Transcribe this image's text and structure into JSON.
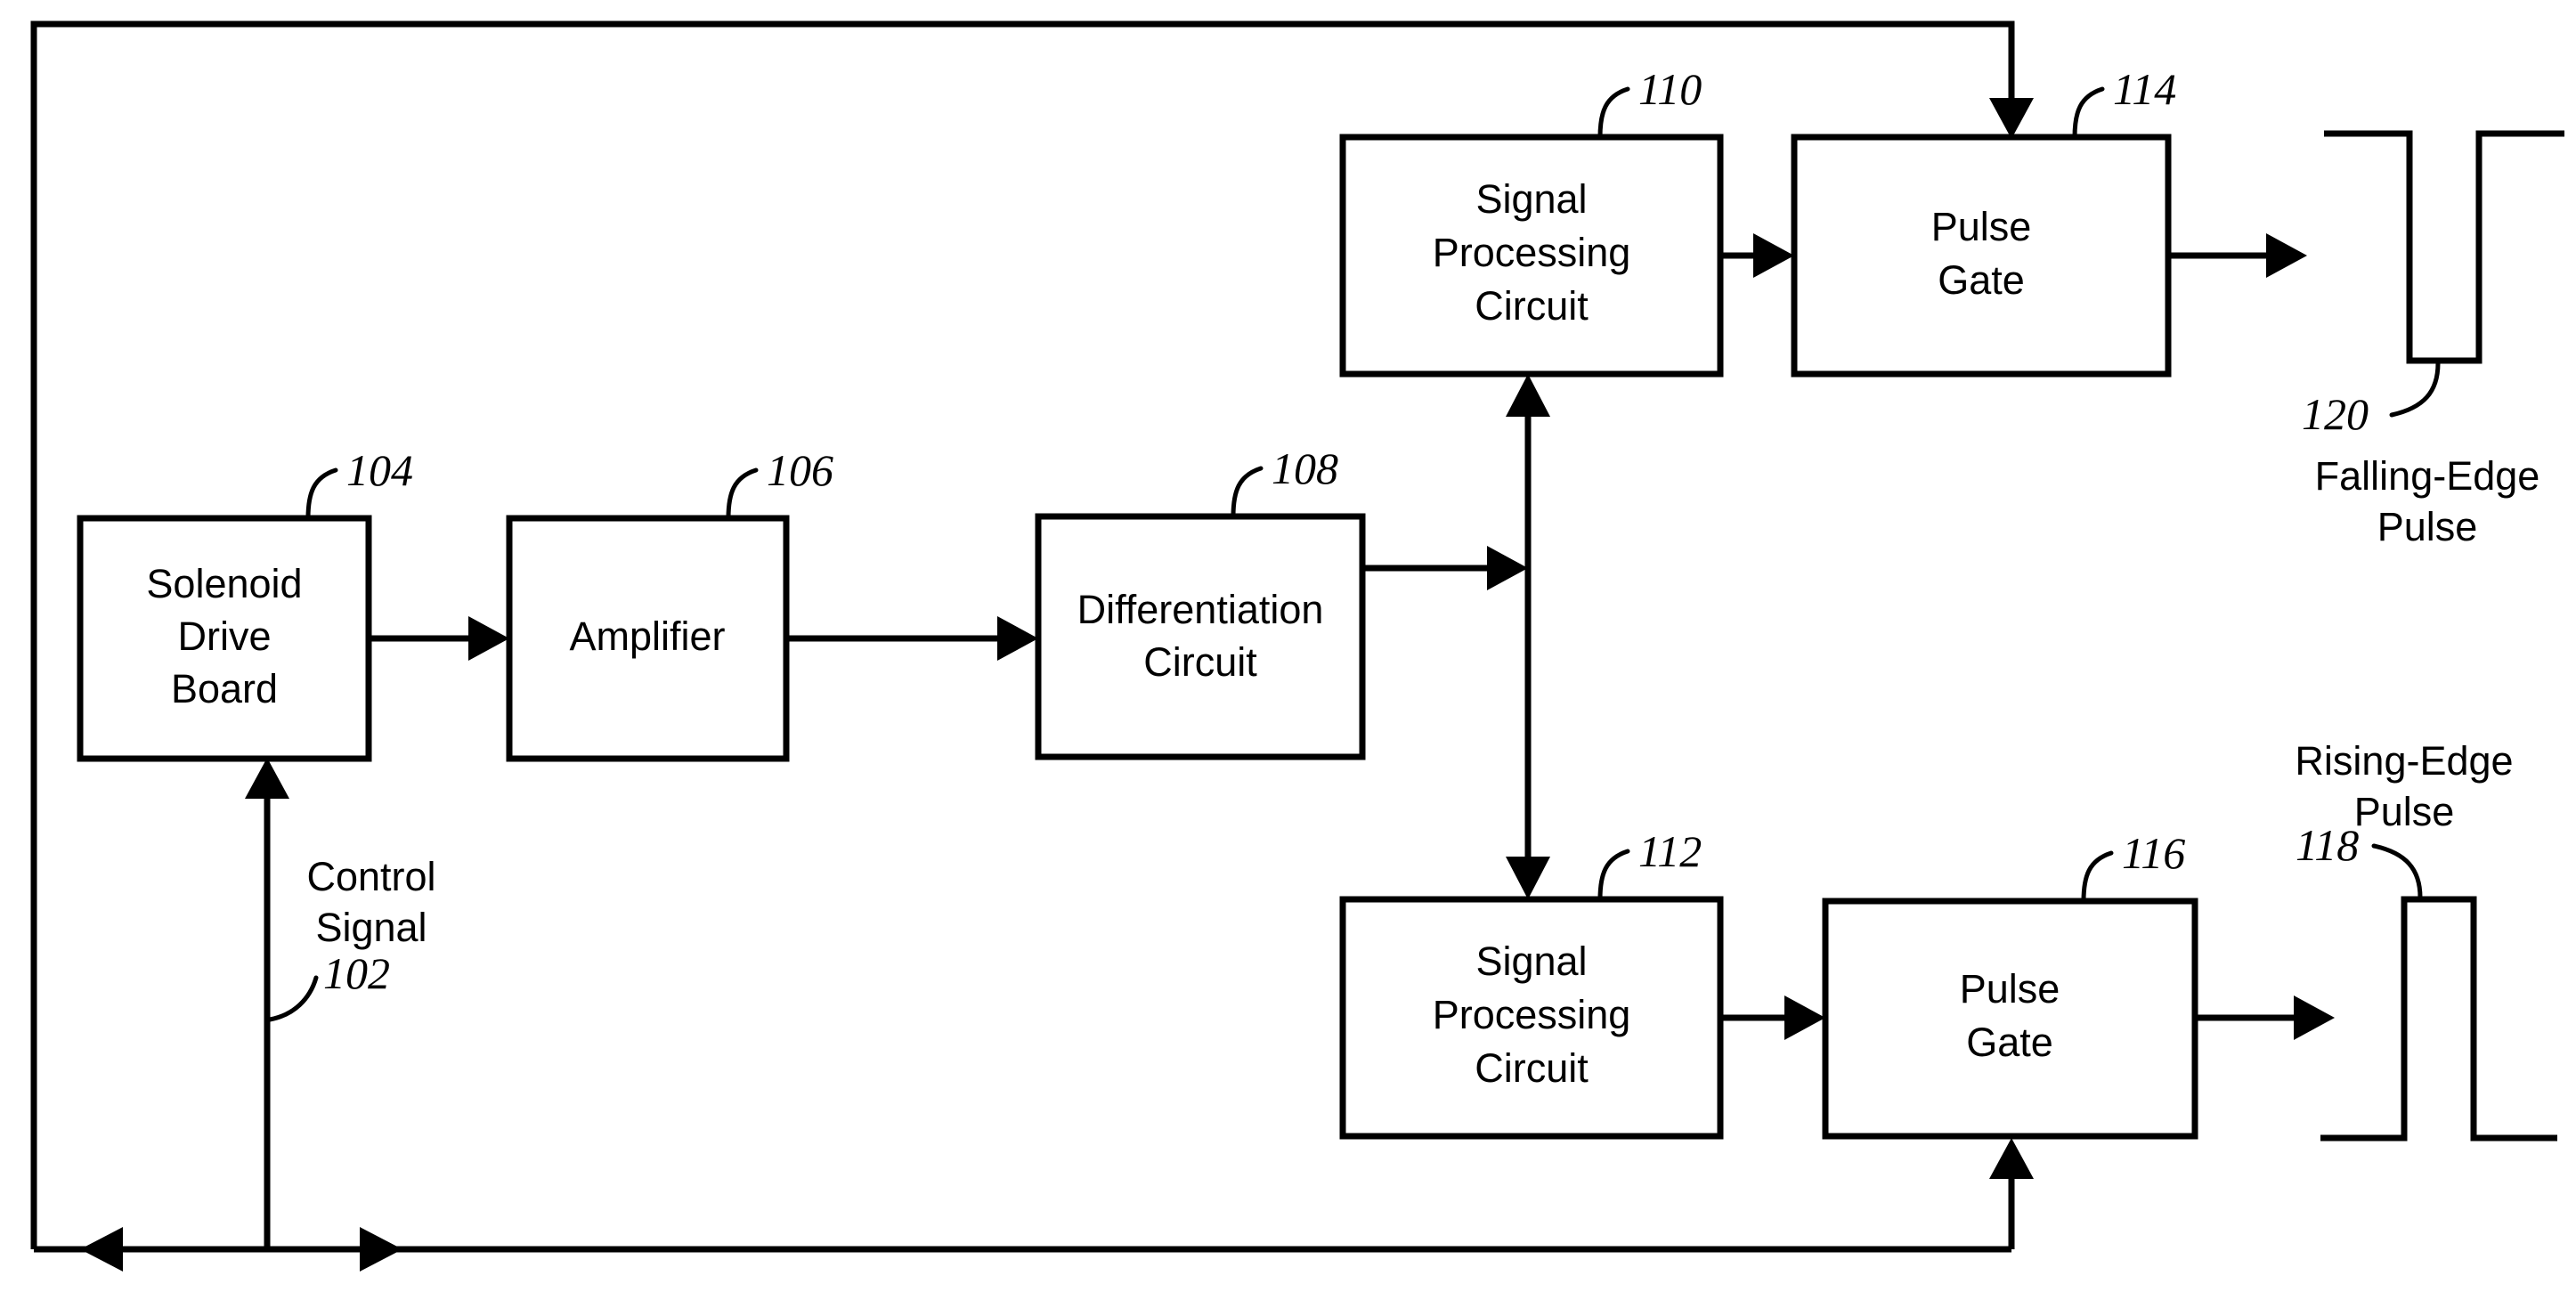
{
  "figure": {
    "type": "patent-block-diagram",
    "background_color": "#ffffff",
    "line_color": "#000000"
  },
  "blocks": [
    {
      "id": "solenoid-drive-board",
      "ref": "104",
      "lines": [
        "Solenoid",
        "Drive",
        "Board"
      ]
    },
    {
      "id": "amplifier",
      "ref": "106",
      "lines": [
        "Amplifier"
      ]
    },
    {
      "id": "differentiation-circuit",
      "ref": "108",
      "lines": [
        "Differentiation",
        "Circuit"
      ]
    },
    {
      "id": "signal-processing-circuit-upper",
      "ref": "110",
      "lines": [
        "Signal",
        "Processing",
        "Circuit"
      ]
    },
    {
      "id": "signal-processing-circuit-lower",
      "ref": "112",
      "lines": [
        "Signal",
        "Processing",
        "Circuit"
      ]
    },
    {
      "id": "pulse-gate-upper",
      "ref": "114",
      "lines": [
        "Pulse",
        "Gate"
      ]
    },
    {
      "id": "pulse-gate-lower",
      "ref": "116",
      "lines": [
        "Pulse",
        "Gate"
      ]
    }
  ],
  "signals": {
    "control_signal": {
      "line1": "Control",
      "line2": "Signal",
      "ref": "102"
    },
    "falling_edge_pulse": {
      "line1": "Falling-Edge",
      "line2": "Pulse",
      "ref": "120"
    },
    "rising_edge_pulse": {
      "line1": "Rising-Edge",
      "line2": "Pulse",
      "ref": "118"
    }
  },
  "refs": {
    "r102": "102",
    "r104": "104",
    "r106": "106",
    "r108": "108",
    "r110": "110",
    "r112": "112",
    "r114": "114",
    "r116": "116",
    "r118": "118",
    "r120": "120"
  },
  "labels": {
    "solenoid_l1": "Solenoid",
    "solenoid_l2": "Drive",
    "solenoid_l3": "Board",
    "amplifier_l1": "Amplifier",
    "diff_l1": "Differentiation",
    "diff_l2": "Circuit",
    "spc_upper_l1": "Signal",
    "spc_upper_l2": "Processing",
    "spc_upper_l3": "Circuit",
    "spc_lower_l1": "Signal",
    "spc_lower_l2": "Processing",
    "spc_lower_l3": "Circuit",
    "pg_upper_l1": "Pulse",
    "pg_upper_l2": "Gate",
    "pg_lower_l1": "Pulse",
    "pg_lower_l2": "Gate",
    "control_l1": "Control",
    "control_l2": "Signal",
    "falling_l1": "Falling-Edge",
    "falling_l2": "Pulse",
    "rising_l1": "Rising-Edge",
    "rising_l2": "Pulse"
  }
}
